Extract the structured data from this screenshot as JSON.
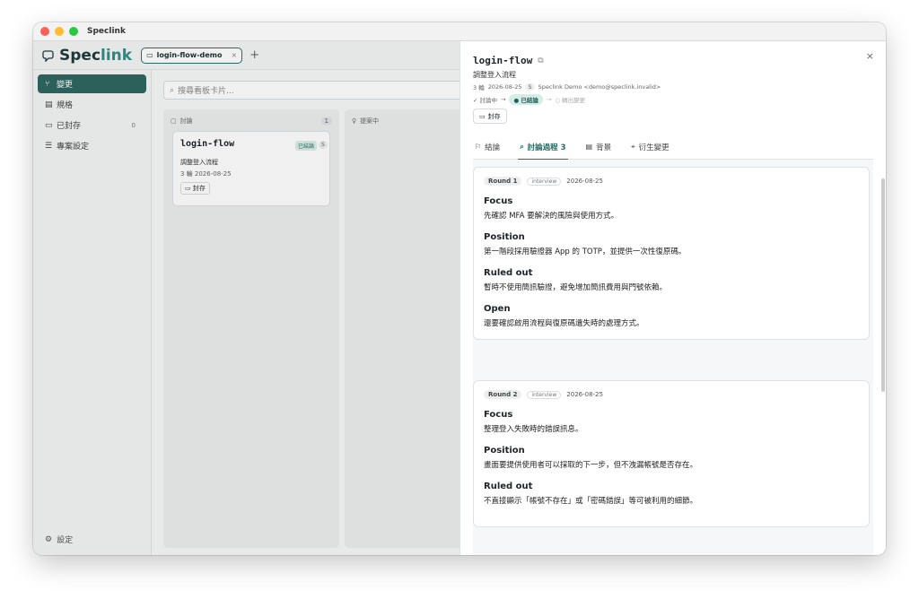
{
  "window": {
    "title": "Speclink"
  },
  "header": {
    "logo_prefix": "Spec",
    "logo_accent": "link",
    "repo_tab": "login-flow-demo",
    "repo_tab_close": "×",
    "add_tab": "+"
  },
  "sidebar": {
    "items": [
      {
        "icon": "⑂",
        "label": "變更"
      },
      {
        "icon": "▤",
        "label": "規格"
      },
      {
        "icon": "▭",
        "label": "已封存",
        "count": "0"
      },
      {
        "icon": "☰",
        "label": "專案設定"
      }
    ],
    "settings_label": "設定"
  },
  "board": {
    "search_placeholder": "搜尋看板卡片...",
    "columns": [
      {
        "label": "討論",
        "count": "1"
      },
      {
        "label": "提案中"
      }
    ],
    "card": {
      "title": "login-flow",
      "badge": "已結論",
      "sbadge": "S",
      "subtitle": "調整登入流程",
      "meta": "3 輪  2026-08-25",
      "archive": "封存"
    }
  },
  "drawer": {
    "title": "login-flow",
    "subtitle": "調整登入流程",
    "meta": {
      "rounds": "3 輪",
      "date": "2026-08-25",
      "size": "S",
      "author": "Speclink Demo <demo@speclink.invalid>"
    },
    "flow": {
      "done": "✓ 討論中",
      "arrow": "→",
      "current": "● 已結論",
      "next": "○ 轉出變更"
    },
    "archive_label": "封存",
    "close": "×",
    "tabs": [
      {
        "icon": "⚐",
        "label": "結論"
      },
      {
        "icon": "⌕",
        "label": "討論過程 3"
      },
      {
        "icon": "▤",
        "label": "背景"
      },
      {
        "icon": "⌖",
        "label": "衍生變更"
      }
    ],
    "rounds": [
      {
        "round": "Round 1",
        "type": "interview",
        "date": "2026-08-25",
        "sections": [
          {
            "label": "Focus",
            "text": "先確認 MFA 要解決的風險與使用方式。"
          },
          {
            "label": "Position",
            "text": "第一階段採用驗證器 App 的 TOTP，並提供一次性復原碼。"
          },
          {
            "label": "Ruled out",
            "text": "暫時不使用簡訊驗證，避免增加簡訊費用與門號依賴。"
          },
          {
            "label": "Open",
            "text": "還要確認啟用流程與復原碼遺失時的處理方式。"
          }
        ]
      },
      {
        "round": "Round 2",
        "type": "interview",
        "date": "2026-08-25",
        "sections": [
          {
            "label": "Focus",
            "text": "整理登入失敗時的錯誤訊息。"
          },
          {
            "label": "Position",
            "text": "畫面要提供使用者可以採取的下一步，但不洩漏帳號是否存在。"
          },
          {
            "label": "Ruled out",
            "text": "不直接顯示「帳號不存在」或「密碼錯誤」等可被利用的細節。"
          }
        ]
      }
    ]
  },
  "colors": {
    "accent": "#2f6661",
    "badge_bg": "#d5ede7",
    "active_tab": "#2a6d66"
  }
}
